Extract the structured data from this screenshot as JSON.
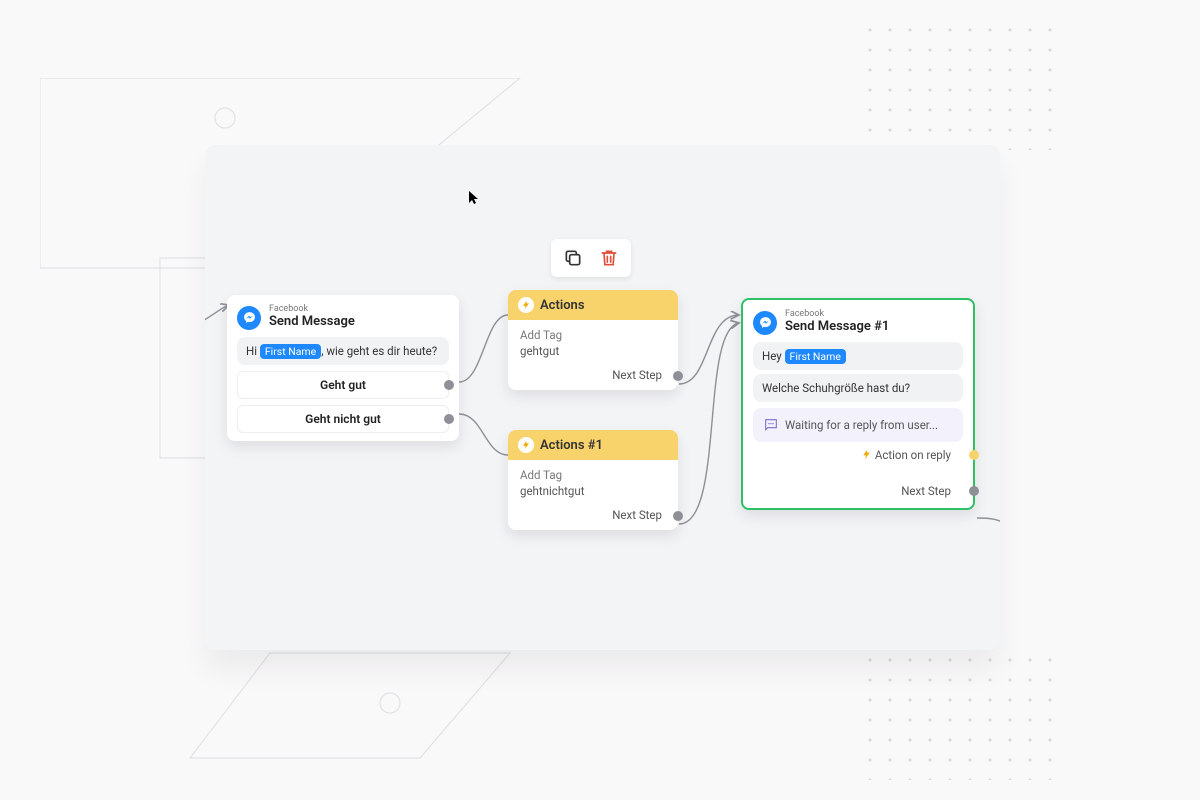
{
  "toolbar": {
    "copy_icon": "copy-icon",
    "trash_icon": "trash-icon"
  },
  "node1": {
    "platform": "Facebook",
    "title": "Send Message",
    "message_pre": "Hi ",
    "message_variable": "First Name",
    "message_post": ", wie geht es dir heute?",
    "reply_options": [
      "Geht gut",
      "Geht nicht gut"
    ]
  },
  "node2": {
    "title": "Actions",
    "action_label": "Add Tag",
    "tag_value": "gehtgut",
    "next_step": "Next Step"
  },
  "node3": {
    "title": "Actions #1",
    "action_label": "Add Tag",
    "tag_value": "gehtnichtgut",
    "next_step": "Next Step"
  },
  "node4": {
    "platform": "Facebook",
    "title": "Send Message #1",
    "message1_pre": "Hey ",
    "message1_variable": "First Name",
    "message2": "Welche Schuhgröße hast du?",
    "waiting_text": "Waiting for a reply from user...",
    "action_on_reply": "Action on reply",
    "next_step": "Next Step"
  }
}
